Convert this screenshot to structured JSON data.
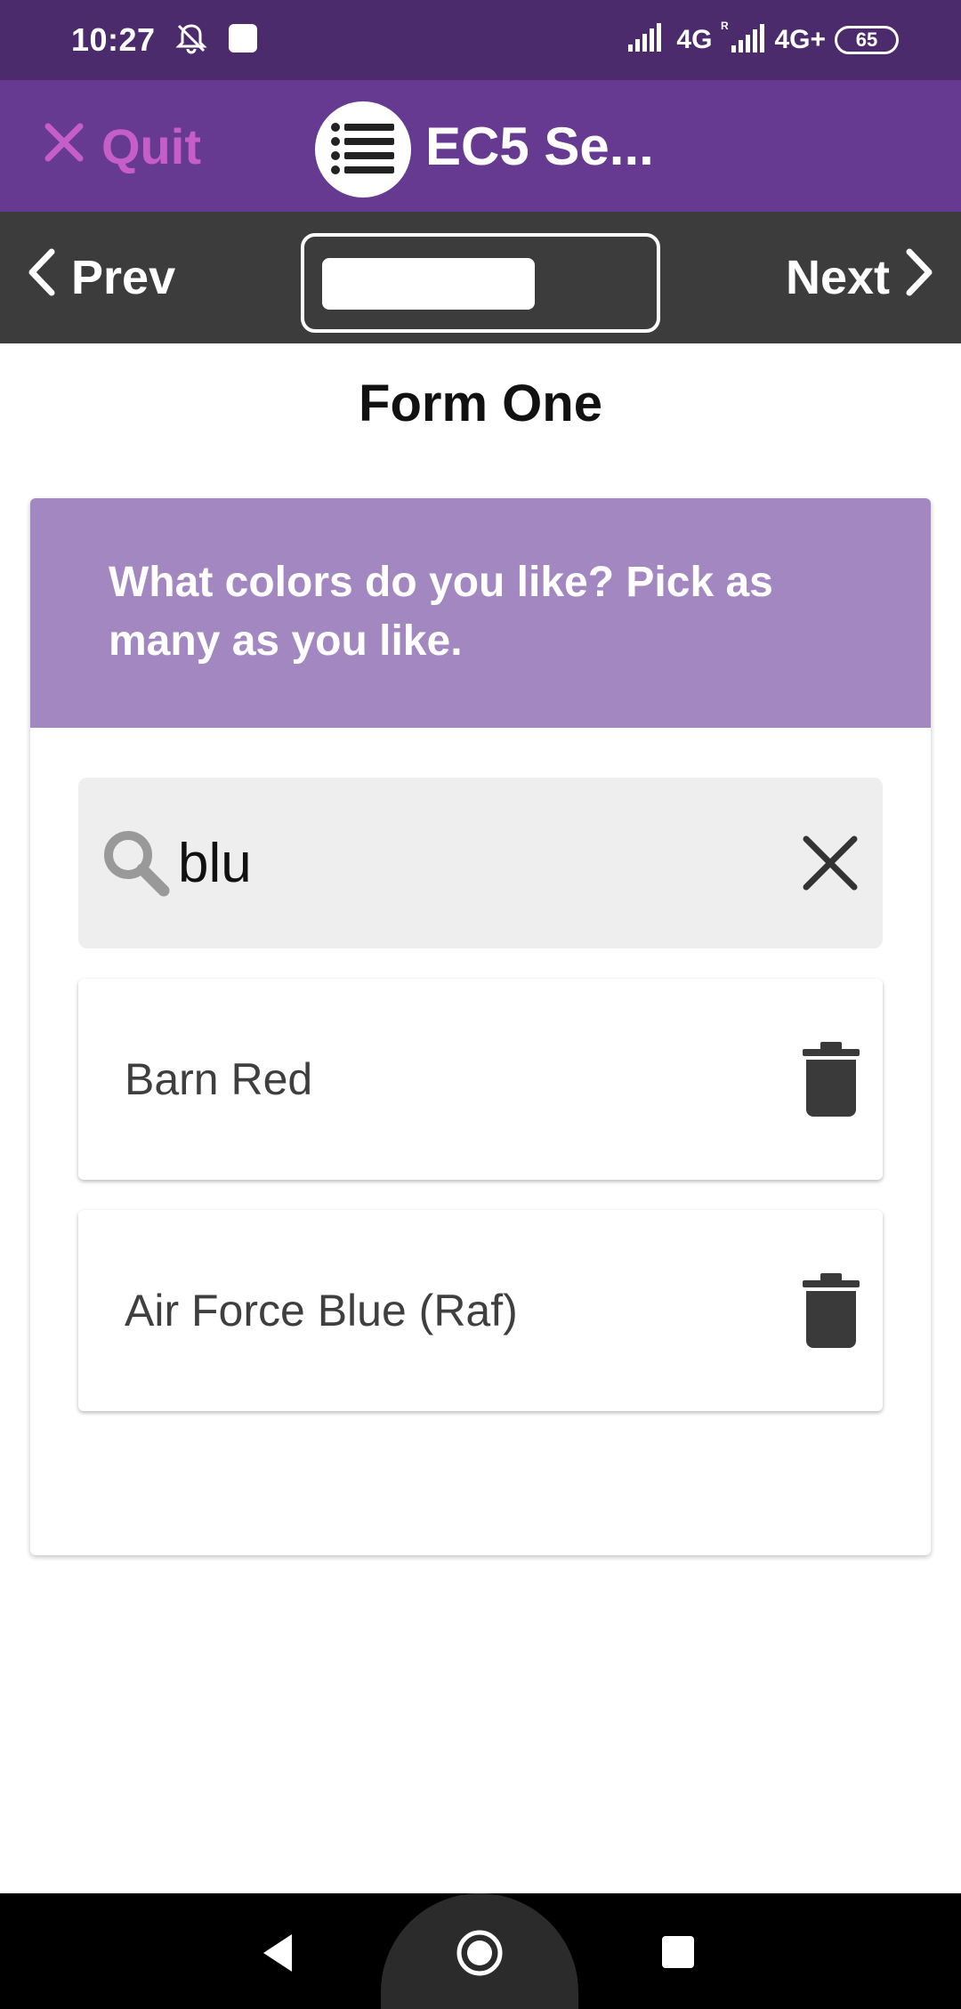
{
  "status_bar": {
    "time": "10:27",
    "network_1": "4G",
    "network_2": "4G+",
    "battery": "65",
    "icons": [
      "bell-muted-icon",
      "notification-square-icon",
      "signal-icon",
      "roaming-signal-icon"
    ]
  },
  "app_header": {
    "quit_label": "Quit",
    "title": "EC5 Se...",
    "logo_icon": "list-icon",
    "background": "#673a91",
    "quit_color": "#c65ec7"
  },
  "nav": {
    "prev_label": "Prev",
    "next_label": "Next",
    "progress": 0.67
  },
  "form": {
    "title": "Form One",
    "question": "What colors do you like? Pick as many as you like.",
    "search": {
      "value": "blu",
      "icon": "search-icon",
      "clear_icon": "close-icon"
    },
    "selected_items": [
      {
        "label": "Barn Red"
      },
      {
        "label": "Air Force Blue (Raf)"
      }
    ]
  },
  "system_nav": {
    "icons": [
      "back-triangle-icon",
      "home-circle-icon",
      "recents-square-icon"
    ]
  }
}
